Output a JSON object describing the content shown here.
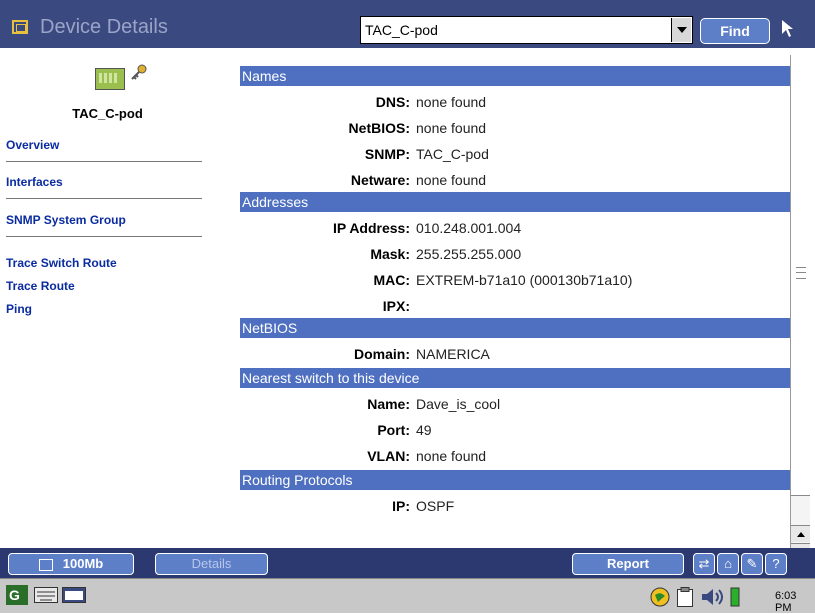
{
  "header": {
    "title": "Device Details",
    "device_select_value": "TAC_C-pod",
    "find_label": "Find",
    "help_glyph": "?"
  },
  "sidebar": {
    "device_name": "TAC_C-pod",
    "items": [
      {
        "label": "Overview"
      },
      {
        "label": "Interfaces"
      },
      {
        "label": "SNMP System Group"
      },
      {
        "label": "Trace Switch Route"
      },
      {
        "label": "Trace Route"
      },
      {
        "label": "Ping"
      }
    ]
  },
  "details": {
    "names_header": "Names",
    "dns_label": "DNS:",
    "dns_value": "none found",
    "netbios_label": "NetBIOS:",
    "netbios_value": "none found",
    "snmp_label": "SNMP:",
    "snmp_value": "TAC_C-pod",
    "netware_label": "Netware:",
    "netware_value": "none found",
    "addresses_header": "Addresses",
    "ip_label": "IP Address:",
    "ip_value": "010.248.001.004",
    "mask_label": "Mask:",
    "mask_value": "255.255.255.000",
    "mac_label": "MAC:",
    "mac_value": "EXTREM-b71a10 (000130b71a10)",
    "ipx_label": "IPX:",
    "ipx_value": "",
    "netbios_header": "NetBIOS",
    "domain_label": "Domain:",
    "domain_value": "NAMERICA",
    "switch_header": "Nearest switch to this device",
    "name_label": "Name:",
    "name_value": "Dave_is_cool",
    "port_label": "Port:",
    "port_value": "49",
    "vlan_label": "VLAN:",
    "vlan_value": "none found",
    "routing_header": "Routing Protocols",
    "rip_label": "IP:",
    "rip_value": "OSPF"
  },
  "bottom": {
    "speed_label": "100Mb",
    "details_label": "Details",
    "report_label": "Report"
  },
  "taskbar": {
    "clock": "6:03 PM"
  },
  "colors": {
    "titlebar": "#3a4a80",
    "section_header": "#4f70c0",
    "link": "#0a2ca0"
  }
}
